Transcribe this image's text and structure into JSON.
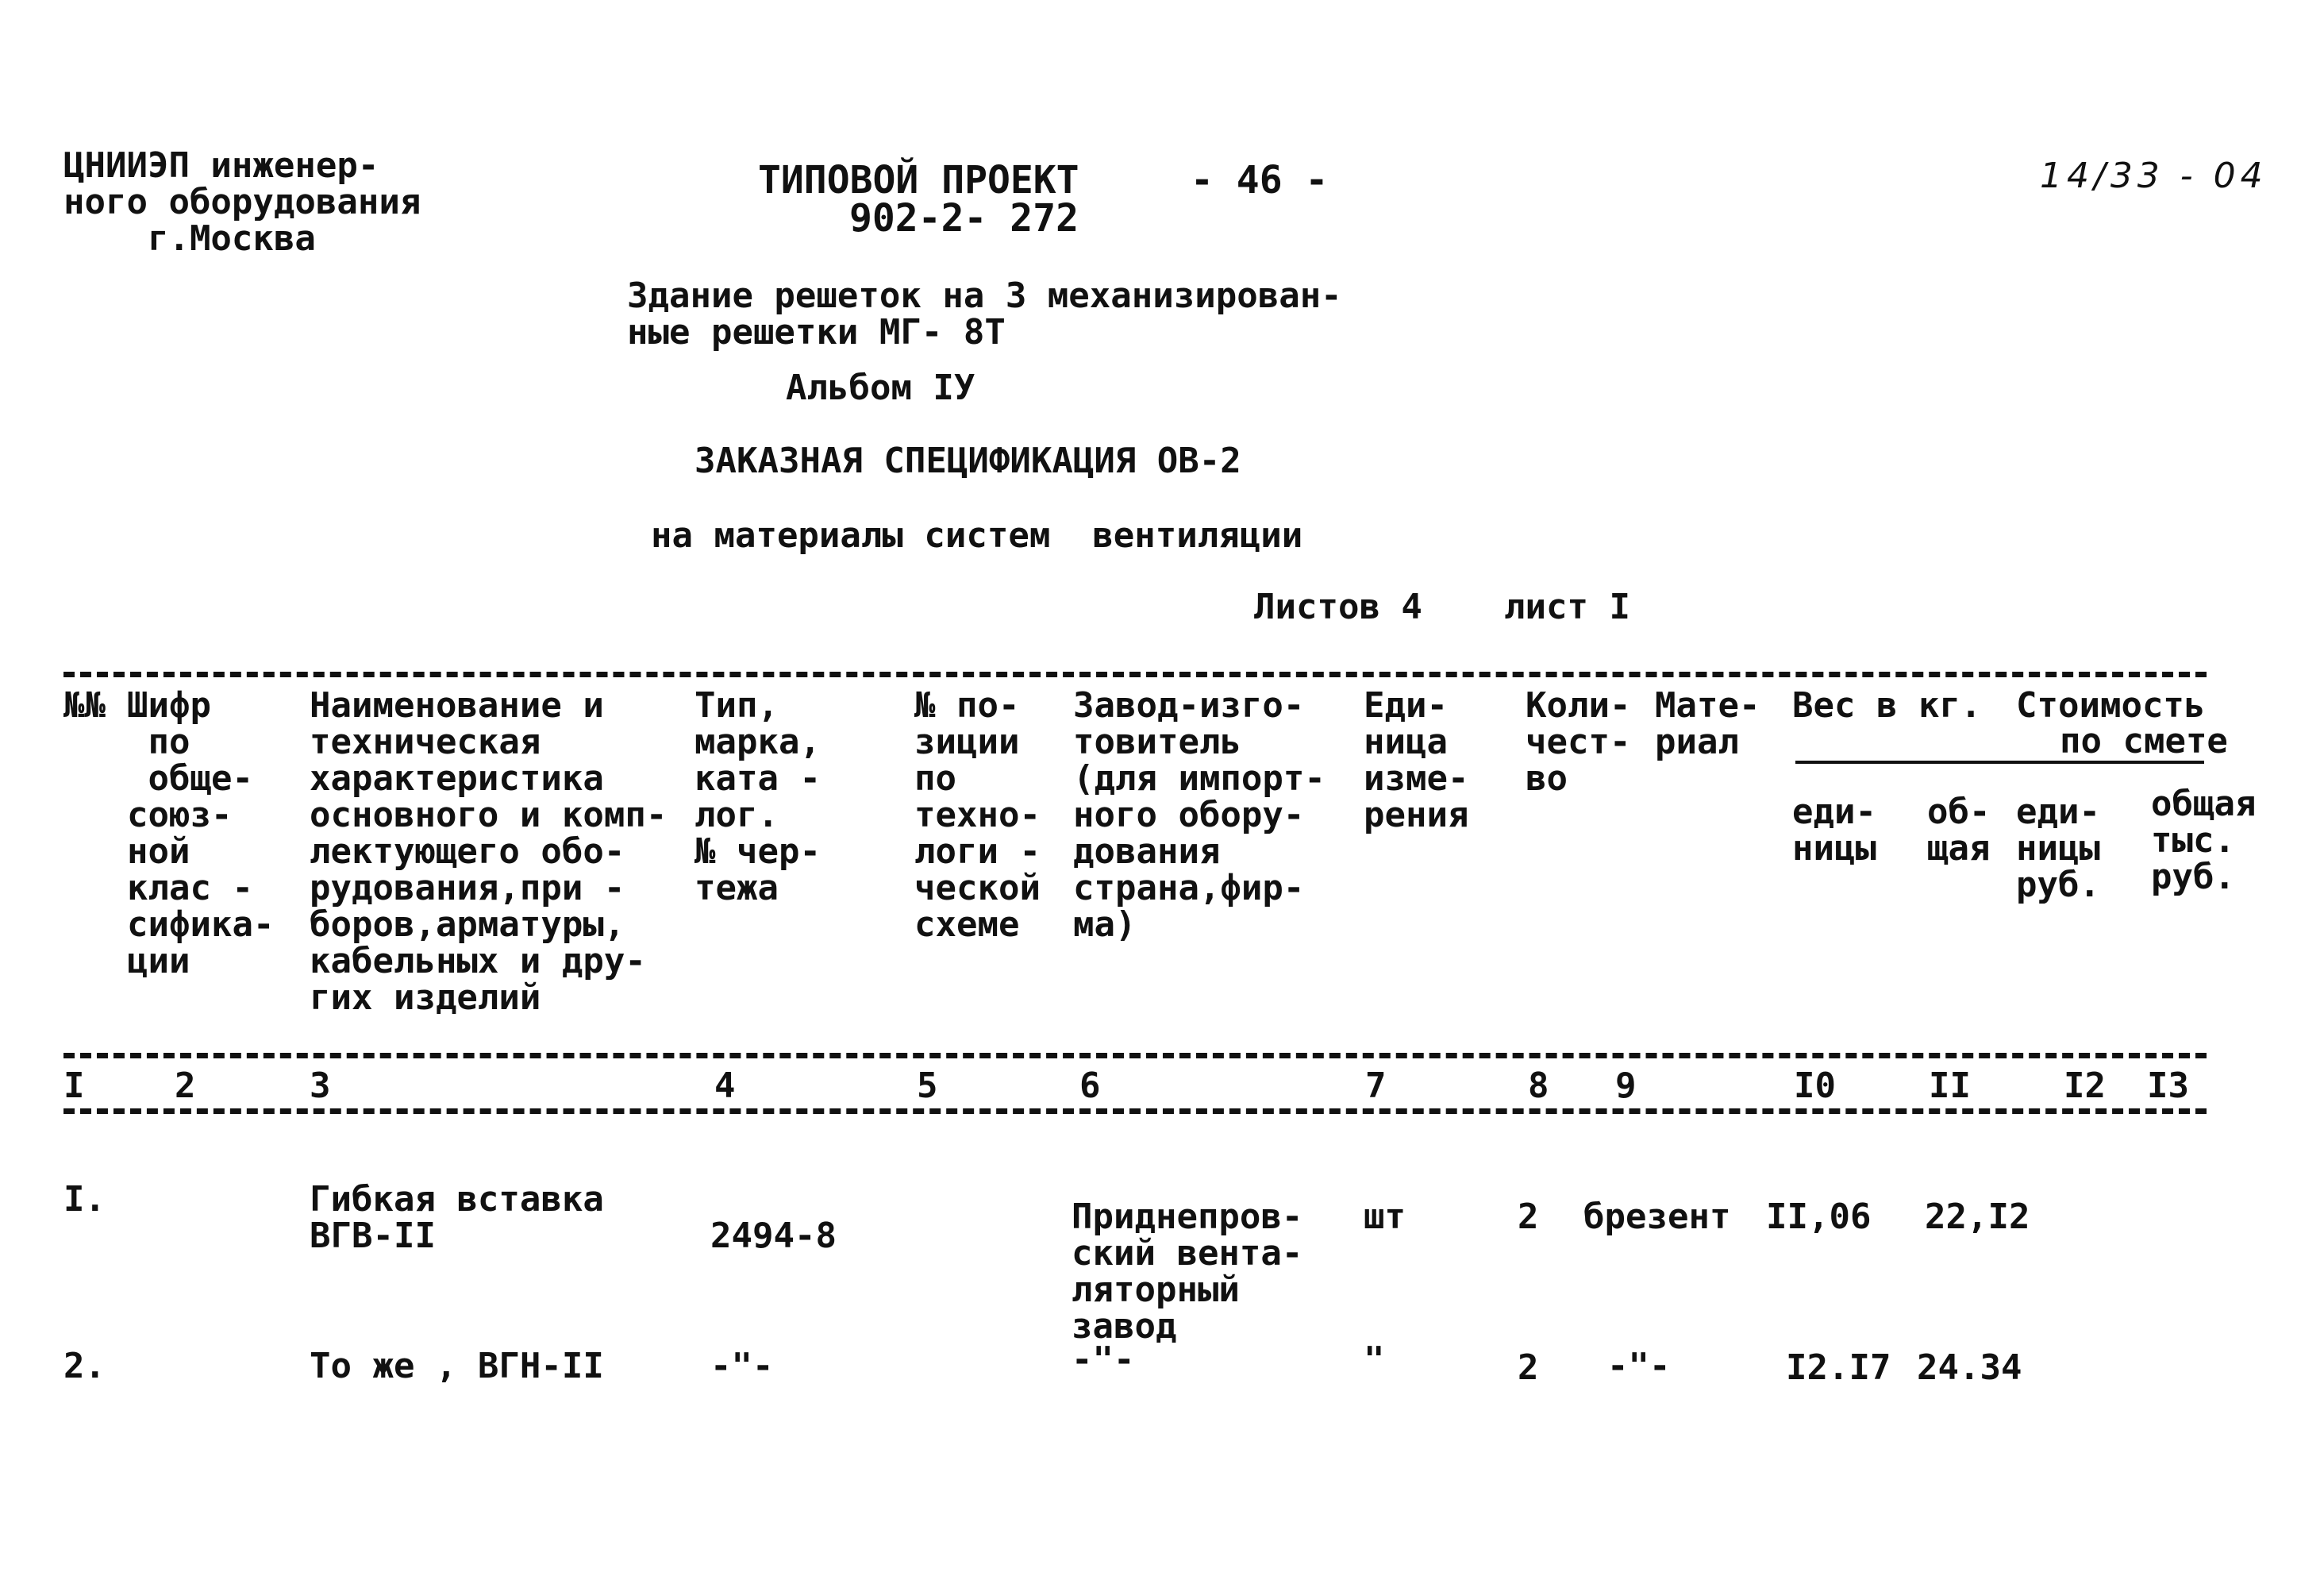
{
  "header": {
    "org_lines": [
      "ЦНИИЭП инженер-",
      "ного оборудования",
      "    г.Москва"
    ],
    "project_label": "ТИПОВОЙ ПРОЕКТ",
    "project_number": "902-2- 272",
    "page_number": "- 46 -",
    "handwritten_code": "14/33 - 04"
  },
  "title": {
    "building_line1": "Здание решеток на 3 механизирован-",
    "building_line2": "ные решетки МГ- 8Т",
    "album": "Альбом IУ",
    "spec_title": "ЗАКАЗНАЯ СПЕЦИФИКАЦИЯ ОВ-2",
    "spec_subtitle": "на материалы систем  вентиляции",
    "sheets": "Листов 4",
    "sheet": "лист I"
  },
  "table": {
    "headers": {
      "col1": "№№",
      "col2": "Шифр\n по\n обще-\nсоюз-\nной\nклас -\nсифика-\nции",
      "col3": "Наименование и\nтехническая\nхарактеристика\nосновного и комп-\nлектующего обо-\nрудования,при -\nборов,арматуры,\nкабельных и дру-\nгих изделий",
      "col4": "Тип,\nмарка,\nката -\nлог.\n№ чер-\nтежа",
      "col5": "№ по-\nзиции\nпо\nтехно-\nлоги -\nческой\nсхеме",
      "col6": "Завод-изго-\nтовитель\n(для импорт-\nного обору-\nдования\nстрана,фир-\nма)",
      "col7": "Еди-\nница\nизме-\nрения",
      "col8": "Коли-\nчест-\nво",
      "col9": "Мате-\nриал",
      "weight_group": "Вес в кг.",
      "cost_group_line1": "Стоимость",
      "cost_group_line2": "по смете",
      "col10": "еди-\nницы",
      "col11": "об-\nщая",
      "col12": "еди-\nницы\nруб.",
      "col13": "общая\nтыс.\nруб."
    },
    "column_numbers": [
      "I",
      "2",
      "3",
      "4",
      "5",
      "6",
      "7",
      "8",
      "9",
      "I0",
      "II",
      "I2",
      "I3"
    ],
    "rows": [
      {
        "num": "I.",
        "code": "",
        "name": "Гибкая вставка\nВГВ-II",
        "type": "2494-8",
        "position": "",
        "manufacturer": "Приднепров-\nский вента-\nляторный\nзавод",
        "unit": "шт",
        "quantity": "2",
        "material": "брезент",
        "weight_unit": "II,06",
        "weight_total": "22,I2",
        "cost_unit": "",
        "cost_total": ""
      },
      {
        "num": "2.",
        "code": "",
        "name": "То же , ВГН-II",
        "type": "-\"-",
        "position": "",
        "manufacturer": "-\"-",
        "unit": "\"",
        "quantity": "2",
        "material": "-\"-",
        "weight_unit": "I2.I7",
        "weight_total": "24.34",
        "cost_unit": "",
        "cost_total": ""
      }
    ]
  }
}
